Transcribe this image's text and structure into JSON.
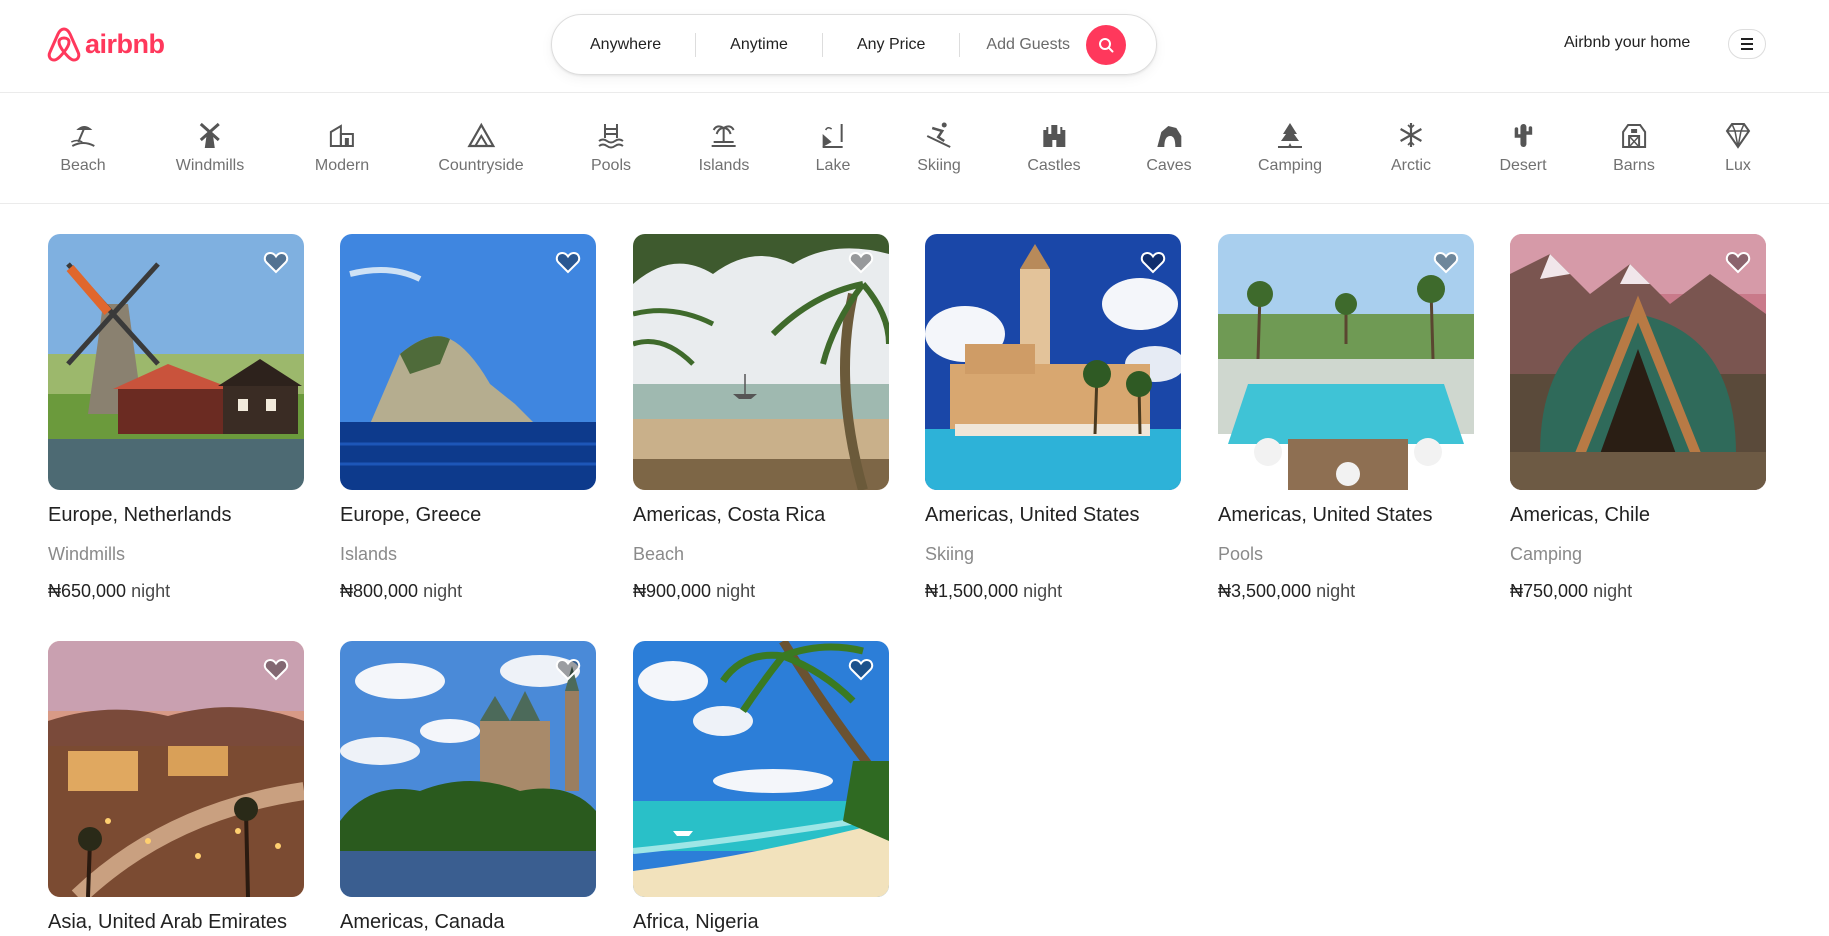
{
  "brand": {
    "name": "airbnb",
    "color": "#ff385c"
  },
  "search": {
    "where": "Anywhere",
    "when": "Anytime",
    "price": "Any Price",
    "guests": "Add Guests",
    "icon": "search-icon"
  },
  "header": {
    "host_link": "Airbnb your home",
    "menu_icon": "hamburger-menu-icon"
  },
  "categories": [
    {
      "label": "Beach",
      "icon": "beach-icon"
    },
    {
      "label": "Windmills",
      "icon": "windmill-icon"
    },
    {
      "label": "Modern",
      "icon": "modern-house-icon"
    },
    {
      "label": "Countryside",
      "icon": "mountain-icon"
    },
    {
      "label": "Pools",
      "icon": "pool-icon"
    },
    {
      "label": "Islands",
      "icon": "island-icon"
    },
    {
      "label": "Lake",
      "icon": "lake-icon"
    },
    {
      "label": "Skiing",
      "icon": "skiing-icon"
    },
    {
      "label": "Castles",
      "icon": "castle-icon"
    },
    {
      "label": "Caves",
      "icon": "cave-icon"
    },
    {
      "label": "Camping",
      "icon": "camping-icon"
    },
    {
      "label": "Arctic",
      "icon": "snowflake-icon"
    },
    {
      "label": "Desert",
      "icon": "cactus-icon"
    },
    {
      "label": "Barns",
      "icon": "barn-icon"
    },
    {
      "label": "Lux",
      "icon": "diamond-icon"
    }
  ],
  "listings": [
    {
      "location": "Europe, Netherlands",
      "category": "Windmills",
      "price": "₦650,000",
      "per": "night"
    },
    {
      "location": "Europe, Greece",
      "category": "Islands",
      "price": "₦800,000",
      "per": "night"
    },
    {
      "location": "Americas, Costa Rica",
      "category": "Beach",
      "price": "₦900,000",
      "per": "night"
    },
    {
      "location": "Americas, United States",
      "category": "Skiing",
      "price": "₦1,500,000",
      "per": "night"
    },
    {
      "location": "Americas, United States",
      "category": "Pools",
      "price": "₦3,500,000",
      "per": "night"
    },
    {
      "location": "Americas, Chile",
      "category": "Camping",
      "price": "₦750,000",
      "per": "night"
    },
    {
      "location": "Asia, United Arab Emirates"
    },
    {
      "location": "Americas, Canada"
    },
    {
      "location": "Africa, Nigeria"
    }
  ]
}
